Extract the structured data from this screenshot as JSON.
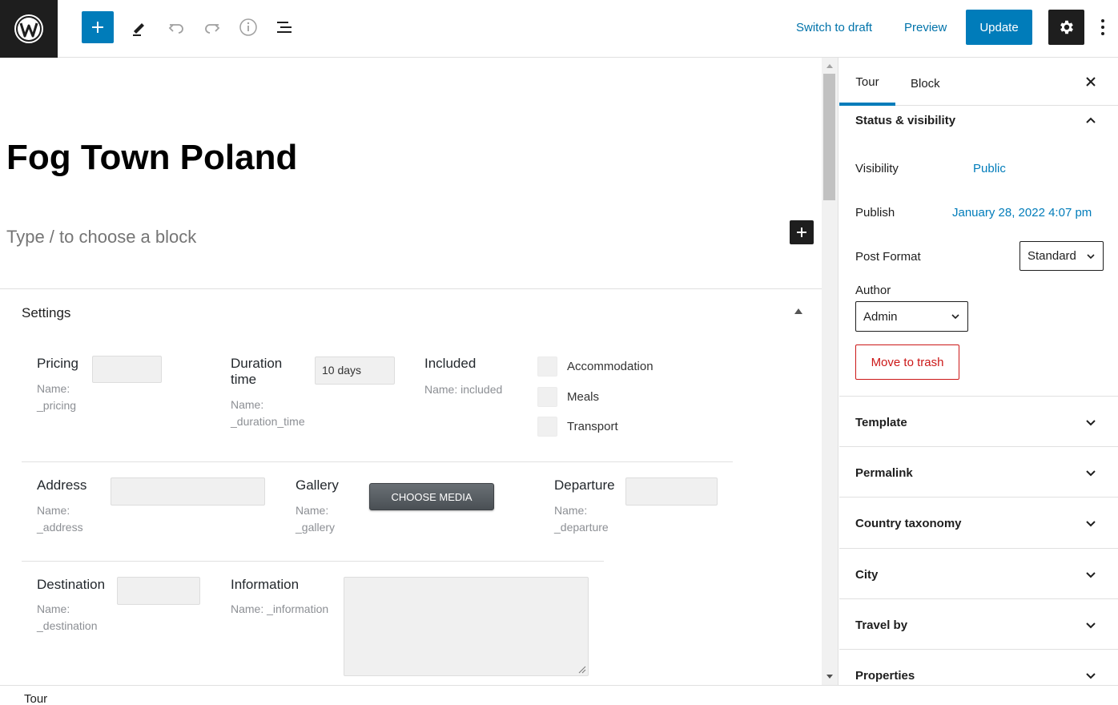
{
  "toolbar": {
    "logo_icon": "wordpress-logo-icon",
    "switch_to_draft": "Switch to draft",
    "preview": "Preview",
    "update": "Update"
  },
  "editor": {
    "title": "Fog Town Poland",
    "placeholder": "Type / to choose a block"
  },
  "meta_box": {
    "title": "Settings",
    "fields": {
      "pricing": {
        "label": "Pricing",
        "name_line1": "Name:",
        "name_line2": "_pricing",
        "value": ""
      },
      "duration": {
        "label_line1": "Duration",
        "label_line2": "time",
        "name_line1": "Name:",
        "name_line2": "_duration_time",
        "value": "10 days"
      },
      "included": {
        "label": "Included",
        "name": "Name: included",
        "options": [
          "Accommodation",
          "Meals",
          "Transport"
        ]
      },
      "address": {
        "label": "Address",
        "name_line1": "Name:",
        "name_line2": "_address",
        "value": ""
      },
      "gallery": {
        "label": "Gallery",
        "name_line1": "Name:",
        "name_line2": "_gallery",
        "button": "CHOOSE MEDIA"
      },
      "departure": {
        "label": "Departure",
        "name_line1": "Name:",
        "name_line2": "_departure",
        "value": ""
      },
      "destination": {
        "label": "Destination",
        "name_line1": "Name:",
        "name_line2": "_destination",
        "value": ""
      },
      "information": {
        "label": "Information",
        "name": "Name: _information",
        "value": ""
      }
    }
  },
  "sidebar": {
    "tabs": [
      "Tour",
      "Block"
    ],
    "status": {
      "title": "Status & visibility",
      "visibility_label": "Visibility",
      "visibility_value": "Public",
      "publish_label": "Publish",
      "publish_value": "January 28, 2022 4:07 pm",
      "post_format_label": "Post Format",
      "post_format_value": "Standard",
      "author_label": "Author",
      "author_value": "Admin",
      "trash": "Move to trash"
    },
    "panels": [
      "Template",
      "Permalink",
      "Country taxonomy",
      "City",
      "Travel by",
      "Properties"
    ]
  },
  "footer": {
    "breadcrumb": "Tour"
  },
  "colors": {
    "accent": "#007cba",
    "dark": "#1e1e1e",
    "danger": "#cc1818"
  }
}
